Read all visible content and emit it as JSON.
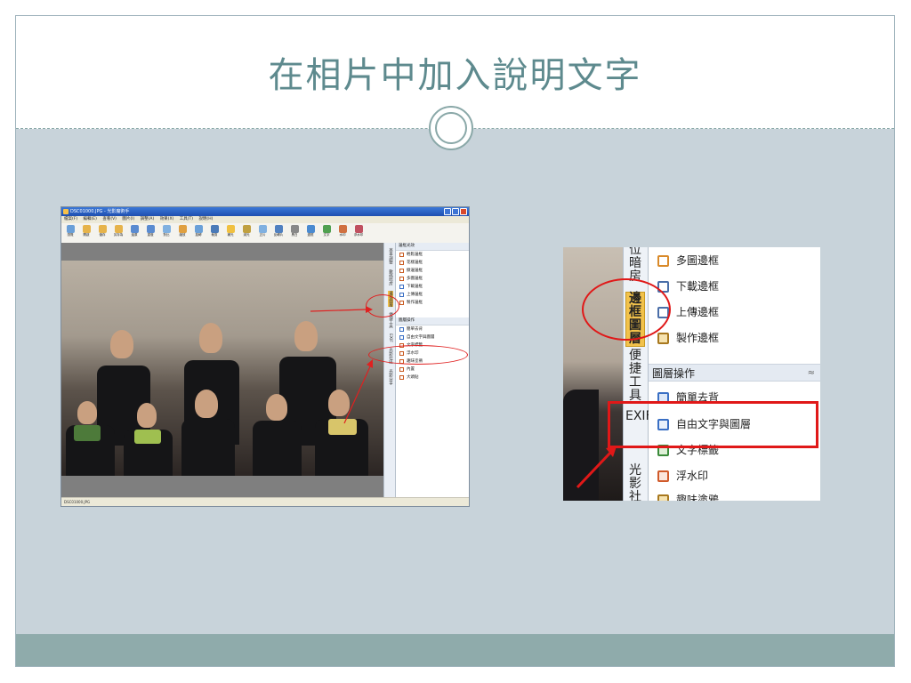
{
  "slide": {
    "title": "在相片中加入說明文字"
  },
  "left_screenshot": {
    "window_title": "DSC01000.JPG - 光影魔術手",
    "menus": [
      "檔案(F)",
      "編輯(E)",
      "查看(V)",
      "圖片(I)",
      "調整(A)",
      "效果(X)",
      "工具(T)",
      "說明(H)"
    ],
    "toolbar": [
      "瀏覽",
      "開啟",
      "儲存",
      "另存為",
      "還原",
      "重做",
      "對比",
      "縮放",
      "旋轉",
      "裁剪",
      "補光",
      "減光",
      "正片",
      "反轉片",
      "黑白",
      "邊框",
      "文字",
      "水印",
      "浮水印"
    ],
    "side_tabs": [
      "基本調整",
      "數碼暗房",
      "邊框圖層",
      "便捷工具",
      "EXIF",
      "光影社區",
      "光影分享"
    ],
    "frame_items": [
      "輕鬆邊框",
      "花樣邊框",
      "撕邊邊框",
      "多圖邊框",
      "下載邊框",
      "上傳邊框",
      "製作邊框"
    ],
    "frame_head": "邊框光效",
    "layer_head": "圖層操作",
    "layer_items": [
      "簡單去背",
      "自由文字與圖層",
      "文字標籤",
      "浮水印",
      "趣味塗鴉",
      "內置",
      "大頭貼"
    ],
    "status": "DSC01000.JPG"
  },
  "right_zoom": {
    "vtab_partial_top": "位暗房",
    "vtab_active": "邊框圖層",
    "vtab_convenience": "便捷工具",
    "vtab_exif": "EXIF",
    "vtab_community": "光影社區",
    "items": [
      "多圖邊框",
      "下載邊框",
      "上傳邊框",
      "製作邊框"
    ],
    "section_label": "圖層操作",
    "section_chevron": "≈",
    "layer_items": [
      "簡單去背",
      "自由文字與圖層",
      "文字標籤",
      "浮水印",
      "趣味塗鴉"
    ]
  },
  "colors": {
    "title": "#5e8a8e",
    "slide_bg": "#c8d3da",
    "footer": "#8fabab",
    "annotation_red": "#e01818",
    "active_tab": "#f2c24b"
  }
}
